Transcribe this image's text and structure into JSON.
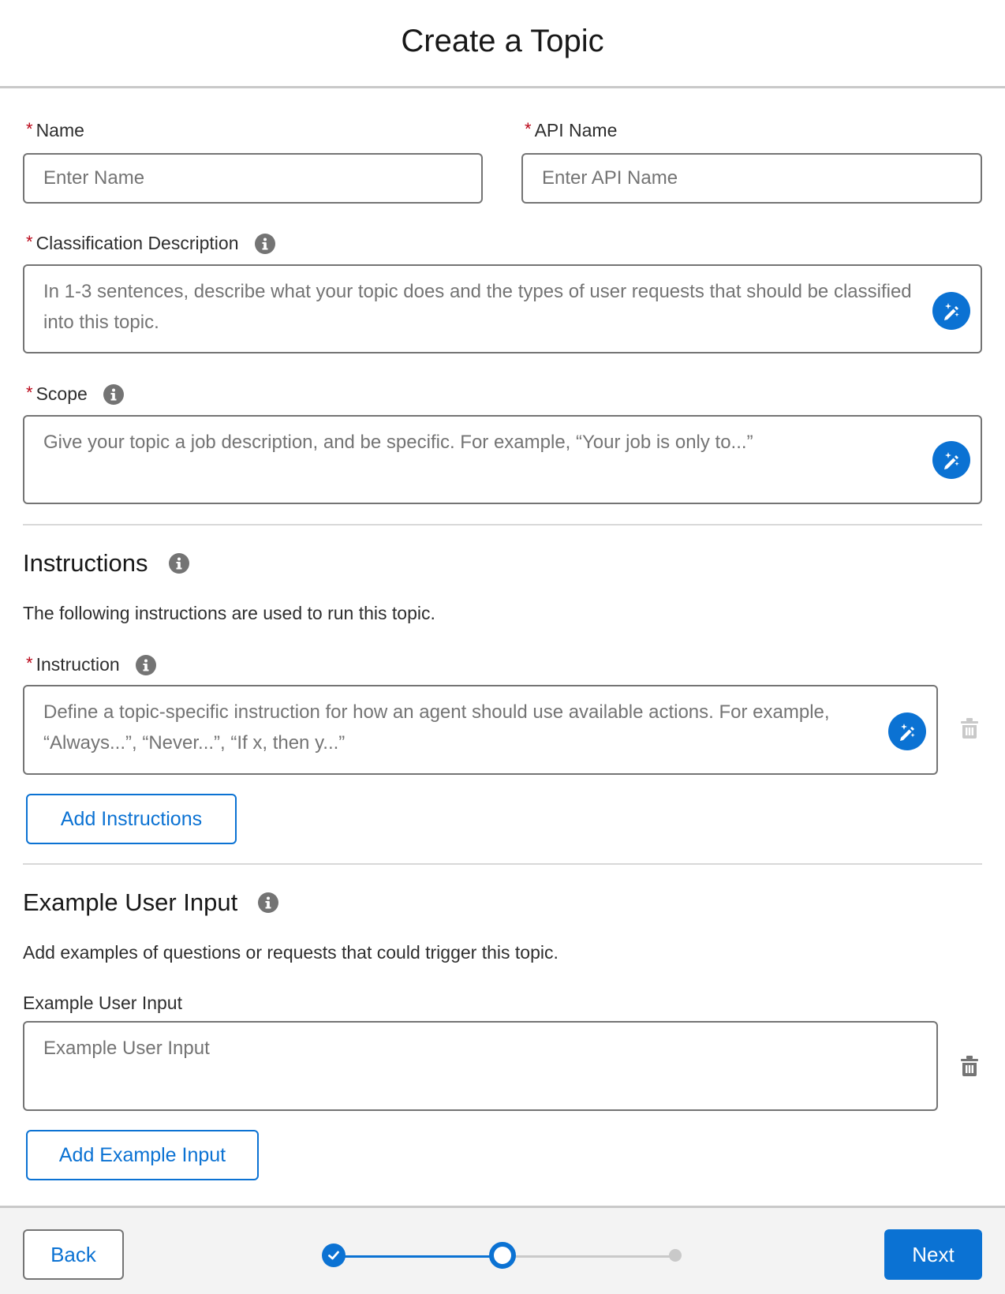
{
  "header": {
    "title": "Create a Topic"
  },
  "fields": {
    "name": {
      "label": "Name",
      "placeholder": "Enter Name",
      "required_marker": "*"
    },
    "api_name": {
      "label": "API Name",
      "placeholder": "Enter API Name",
      "required_marker": "*"
    },
    "classification": {
      "label": "Classification Description",
      "placeholder": "In 1-3 sentences, describe what your topic does and the types of user requests that should be classified into this topic.",
      "required_marker": "*"
    },
    "scope": {
      "label": "Scope",
      "placeholder": "Give your topic a job description, and be specific. For example, “Your job is only to...”",
      "required_marker": "*"
    }
  },
  "instructions": {
    "title": "Instructions",
    "description": "The following instructions are used to run this topic.",
    "instruction": {
      "label": "Instruction",
      "placeholder": "Define a topic-specific instruction for how an agent should use available actions. For example, “Always...”, “Never...”, “If x, then y...”",
      "required_marker": "*"
    },
    "add_button": "Add Instructions"
  },
  "example_input": {
    "title": "Example User Input",
    "description": "Add examples of questions or requests that could trigger this topic.",
    "field": {
      "label": "Example User Input",
      "placeholder": "Example User Input"
    },
    "add_button": "Add Example Input"
  },
  "footer": {
    "back_label": "Back",
    "next_label": "Next"
  },
  "progress": {
    "current_step": 2,
    "total_steps": 3,
    "completed_steps": 1
  },
  "colors": {
    "brand": "#0b72d3",
    "required": "#ba0517",
    "border": "#747474",
    "divider": "#d8d8d8",
    "footer_bg": "#f3f3f3"
  },
  "icons": {
    "info": "info-icon",
    "ai_assist": "magic-pencil-icon",
    "delete": "trash-icon",
    "step_complete": "check-icon"
  }
}
